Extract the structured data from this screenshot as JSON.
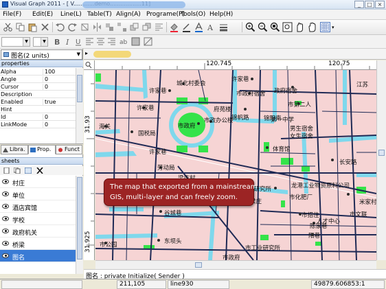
{
  "window": {
    "title": "Visual Graph 2011 - [ V............demo..................11]",
    "controls": {
      "minimize": "_",
      "maximize": "□",
      "close": "×"
    }
  },
  "menu": [
    "File(F)",
    "Edit(E)",
    "Line(L)",
    "Table(T)",
    "Align(A)",
    "Programe(P)",
    "Tools(O)",
    "Help(H)"
  ],
  "toolbar_icons": [
    "cut-icon",
    "copy-icon",
    "paste-icon",
    "delete-icon",
    "undo-icon",
    "redo-icon",
    "rotate-icon",
    "flip-icon",
    "group-icon",
    "ungroup-icon",
    "front-icon",
    "back-icon",
    "align-icon",
    "fill-icon",
    "line-color-icon",
    "text-color-icon",
    "font-icon",
    "zoom-in-icon",
    "zoom-out-icon",
    "zoom-fit-icon",
    "zoom-window-icon",
    "pan-icon",
    "hand-icon",
    "grid-icon"
  ],
  "object_selector": {
    "value": "图名(2 units)"
  },
  "properties": {
    "header": "properties",
    "rows": [
      {
        "key": "Alpha",
        "value": "100"
      },
      {
        "key": "Angle",
        "value": "0"
      },
      {
        "key": "Cursor",
        "value": "0"
      },
      {
        "key": "Description",
        "value": ""
      },
      {
        "key": "Enabled",
        "value": "true"
      },
      {
        "key": "Hint",
        "value": ""
      },
      {
        "key": "Id",
        "value": "0"
      },
      {
        "key": "LinkMode",
        "value": "0"
      }
    ]
  },
  "panel_tabs": [
    "Libra.",
    "Prop.",
    "Funct"
  ],
  "sheets": {
    "header": "sheets",
    "layers": [
      "村庄",
      "单位",
      "酒店宾馆",
      "学校",
      "政府机关",
      "桥梁",
      "图名"
    ],
    "selected": "图名"
  },
  "rulers": {
    "h_labels": [
      "120.745",
      "120.75"
    ],
    "v_labels": [
      "31.93",
      "31.925"
    ]
  },
  "map_labels": [
    "城北村委会",
    "许家巷",
    "许家巷",
    "市政府",
    "市政办公楼",
    "府苑楼",
    "锦帆路",
    "锦阳南",
    "许家巷",
    "国税局",
    "市政府宿舍",
    "许家巷",
    "市第二人",
    "江苏",
    "政府宿舍",
    "第一中学",
    "男生宿舍",
    "女生宿舍",
    "体育馆",
    "长安路",
    "劳动局",
    "梁庄村",
    "谷城巷",
    "东坝头",
    "市公园",
    "龙港工业物资原料公司",
    "市化肥厂",
    "市招住",
    "人才中心",
    "市文联",
    "米家村",
    "陈家巷",
    "市政府",
    "市工业研究所",
    "市工业研究所",
    "阳巷",
    "梁庄",
    "海关"
  ],
  "callout": {
    "line1": "The map that exported from a mainstream",
    "line2": "GIS, multi-layer and can freely zoom."
  },
  "code_status": "图名 : private Initialize( Sender )",
  "status_bar": [
    "211,105",
    "line930",
    "49879.606853:1"
  ],
  "colors": {
    "map_background": "#f6d4d4",
    "water": "#7fd8ec",
    "green": "#35e34a",
    "road": "#1f2a55",
    "callout": "#9c2424",
    "selection": "#3a7bd5"
  }
}
